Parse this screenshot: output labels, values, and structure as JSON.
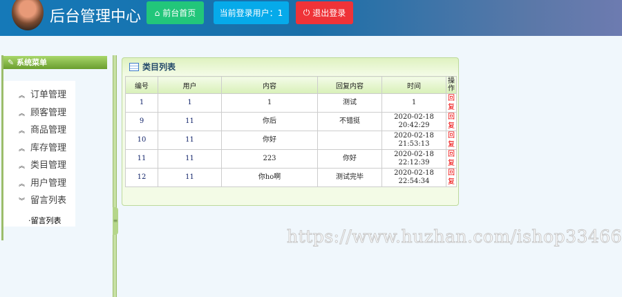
{
  "header": {
    "title": "后台管理中心",
    "home_button": "前台首页",
    "current_user": "当前登录用户：1",
    "logout_button": "退出登录"
  },
  "sidebar": {
    "title": "系统菜单",
    "items": [
      "订单管理",
      "顾客管理",
      "商品管理",
      "库存管理",
      "类目管理",
      "用户管理",
      "留言列表"
    ],
    "sub_item": "·留言列表"
  },
  "panel": {
    "title": "类目列表",
    "columns": [
      "编号",
      "用户",
      "内容",
      "回复内容",
      "时间",
      "操作"
    ],
    "rows": [
      {
        "id": "1",
        "user": "1",
        "content": "1",
        "reply": "测试",
        "date": "1",
        "time": "",
        "action": "回复"
      },
      {
        "id": "9",
        "user": "11",
        "content": "你后",
        "reply": "不错挺",
        "date": "2020-02-18",
        "time": "20:42:29",
        "action": "回复"
      },
      {
        "id": "10",
        "user": "11",
        "content": "你好",
        "reply": "",
        "date": "2020-02-18",
        "time": "21:53:13",
        "action": "回复"
      },
      {
        "id": "11",
        "user": "11",
        "content": "223",
        "reply": "你好",
        "date": "2020-02-18",
        "time": "22:12:39",
        "action": "回复"
      },
      {
        "id": "12",
        "user": "11",
        "content": "你ho啊",
        "reply": "测试完毕",
        "date": "2020-02-18",
        "time": "22:54:34",
        "action": "回复"
      }
    ]
  },
  "watermark": "https://www.huzhan.com/ishop33466"
}
